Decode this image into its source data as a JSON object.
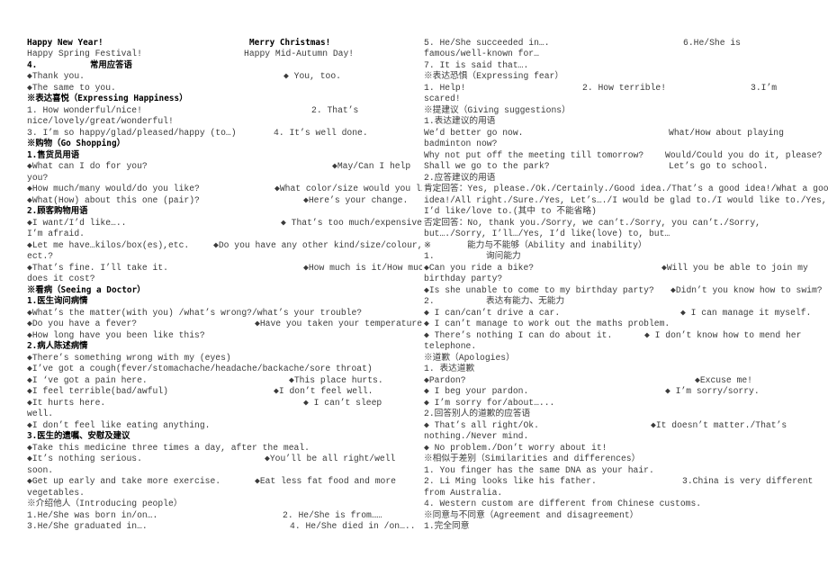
{
  "left": {
    "lines": [
      [
        "Happy New Year!",
        "Merry Christmas!"
      ],
      [
        "Happy Spring Festival!",
        "Happy Mid-Autumn Day!"
      ],
      [
        "4.",
        "常用应答语"
      ],
      [
        "◆Thank you.",
        "◆ You, too."
      ],
      [
        "◆The same to you."
      ],
      [
        "※表达喜悦（Expressing Happiness）"
      ],
      [
        "1. How wonderful/nice!",
        "2. That’s"
      ],
      [
        "nice/lovely/great/wonderful!"
      ],
      [
        "3. I’m so happy/glad/pleased/happy (to…)",
        "4. It’s well done."
      ],
      [
        "※购物（Go Shopping）"
      ],
      [
        "1.售货员用语"
      ],
      [
        "◆What can I do for you?",
        "◆May/Can I help"
      ],
      [
        "you?"
      ],
      [
        "◆How much/many would/do you like?",
        "◆What color/size would you like"
      ],
      [
        "◆What(How) about this one (pair)?",
        "◆Here’s your change."
      ],
      [
        "2.顾客购物用语"
      ],
      [
        "◆I want/I’d like…..",
        "◆ That’s too much/expensive,"
      ],
      [
        "I’m afraid."
      ],
      [
        "◆Let me have…kilos/box(es),etc.",
        "◆Do you have any other kind/size/colour,"
      ],
      [
        "ect.?"
      ],
      [
        "◆That’s fine. I’ll take it.",
        "◆How much is it/How much"
      ],
      [
        "does it cost?"
      ],
      [
        "※看病（Seeing a Doctor）"
      ],
      [
        "1.医生询问病情"
      ],
      [
        "◆What’s the matter(with you) /what’s wrong?/what’s your trouble?"
      ],
      [
        "◆Do you have a fever?",
        "◆Have you taken your temperature?"
      ],
      [
        "◆How long have you been like this?"
      ],
      [
        "2.病人陈述病情"
      ],
      [
        "◆There’s something wrong with my (eyes)"
      ],
      [
        "◆I’ve got a cough(fever/stomachache/headache/backache/sore throat)"
      ],
      [
        "◆I ‘ve got a pain here.",
        "◆This place hurts."
      ],
      [
        "◆I feel terrible(bad/awful)",
        "◆I don’t feel well."
      ],
      [
        "◆It hurts here.",
        "◆ I can’t sleep"
      ],
      [
        "well."
      ],
      [
        "◆I don’t feel like eating anything."
      ],
      [
        "3.医生的遗嘱、安慰及建议"
      ],
      [
        "◆Take this medicine three times a day, after the meal."
      ],
      [
        "◆It’s nothing serious.",
        "◆You’ll be all right/well"
      ],
      [
        "soon."
      ],
      [
        "◆Get up early and take more exercise.",
        "◆Eat less fat food and more"
      ],
      [
        "vegetables."
      ],
      [
        "※介绍他人（Introducing people）"
      ],
      [
        "1.He/She was born in/on….",
        "2. He/She is from……"
      ],
      [
        "3.He/She graduated in….",
        "4. He/She died in /on….."
      ]
    ]
  },
  "right": {
    "lines": [
      [
        "5. He/She succeeded in….",
        "6.He/She is"
      ],
      [
        "famous/well-known for…"
      ],
      [
        "7. It is said that…."
      ],
      [
        "※表达恐惧（Expressing fear）"
      ],
      [
        "1. Help!",
        "2. How terrible!",
        "3.I’m"
      ],
      [
        "scared!"
      ],
      [
        "※提建议（Giving suggestions）"
      ],
      [
        "1.表达建议的用语"
      ],
      [
        "We’d better go now.",
        "What/How about playing"
      ],
      [
        "badminton now?"
      ],
      [
        "Why not put off the meeting till tomorrow?",
        "Would/Could you do it, please?"
      ],
      [
        "Shall we go to the park?",
        "Let’s go to school."
      ],
      [
        "2.应答建议的用语"
      ],
      [
        "肯定回答：Yes, please./Ok./Certainly./Good idea./That’s a good idea!/What a good"
      ],
      [
        "idea!/All right./Sure./Yes, Let’s…./I would be glad to./I would like to./Yes,"
      ],
      [
        "I’d like/love to.(其中 to 不能省略)"
      ],
      [
        "否定回答：No, thank you./Sorry, we can’t./Sorry, you can’t./Sorry,"
      ],
      [
        "but…./Sorry, I’ll…/Yes, I’d like(love) to, but…"
      ],
      [
        "※",
        "能力与不能够（Ability and inability）"
      ],
      [
        "1.",
        "询问能力"
      ],
      [
        "◆Can you ride a bike?",
        "◆Will you be able to join my"
      ],
      [
        "birthday party?"
      ],
      [
        "◆Is she unable to come to my birthday party?",
        "◆Didn’t you know how to swim?"
      ],
      [
        "2.",
        "表达有能力、无能力"
      ],
      [
        "◆ I can/can’t drive a car.",
        "◆ I can manage it myself."
      ],
      [
        "◆ I can’t manage to work out the maths problem."
      ],
      [
        "◆ There’s nothing I can do about it.",
        "◆ I don’t know how to mend her"
      ],
      [
        "telephone."
      ],
      [
        "※道歉（Apologies）"
      ],
      [
        "1. 表达道歉"
      ],
      [
        "◆Pardon?",
        "◆Excuse me!"
      ],
      [
        "◆ I beg your pardon.",
        "◆ I’m sorry/sorry."
      ],
      [
        "◆ I’m sorry for/about…..."
      ],
      [
        "2.回答别人的道歉的应答语"
      ],
      [
        "◆ That’s all right/Ok.",
        "◆It doesn’t matter./That’s"
      ],
      [
        "nothing./Never mind."
      ],
      [
        "◆ No problem./Don’t worry about it!"
      ],
      [
        "※相似于差别（Similarities and differences）"
      ],
      [
        "1. You finger has the same DNA as your hair."
      ],
      [
        "2. Li Ming looks like his father.",
        "3.China is very different"
      ],
      [
        "from Australia."
      ],
      [
        "4. Western custom are different from Chinese customs."
      ],
      [
        "※同意与不同意（Agreement and disagreement）"
      ],
      [
        "1.完全同意"
      ]
    ]
  }
}
